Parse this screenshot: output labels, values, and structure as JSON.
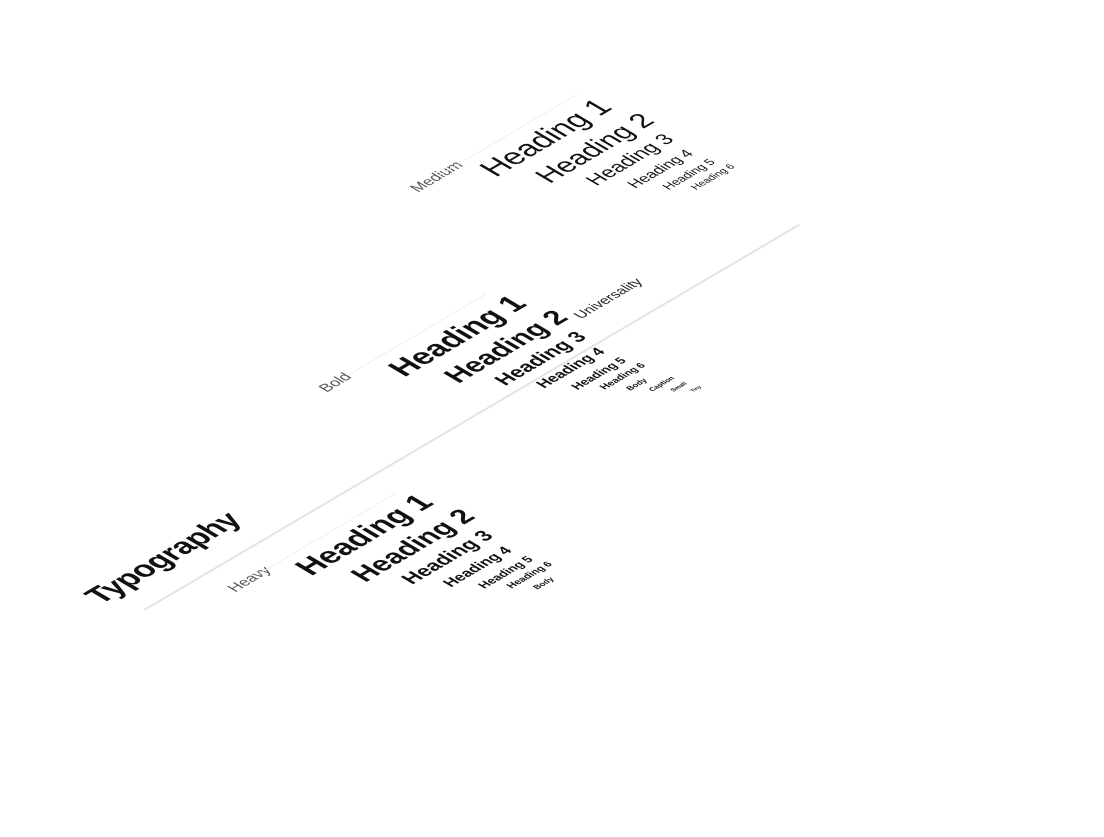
{
  "title": "Typography",
  "columns": [
    {
      "label": "Heavy",
      "items": [
        "Heading 1",
        "Heading 2",
        "Heading 3",
        "Heading 4",
        "Heading 5",
        "Heading 6",
        "Body"
      ]
    },
    {
      "label": "Bold",
      "items": [
        "Heading 1",
        "Heading 2",
        "Heading 3",
        "Heading 4",
        "Heading 5",
        "Heading 6",
        "Body",
        "Caption",
        "Small",
        "Tiny"
      ]
    },
    {
      "label": "Medium",
      "items": [
        "Heading 1",
        "Heading 2",
        "Heading 3",
        "Heading 4",
        "Heading 5",
        "Heading 6"
      ]
    }
  ],
  "section_label": "Universality"
}
